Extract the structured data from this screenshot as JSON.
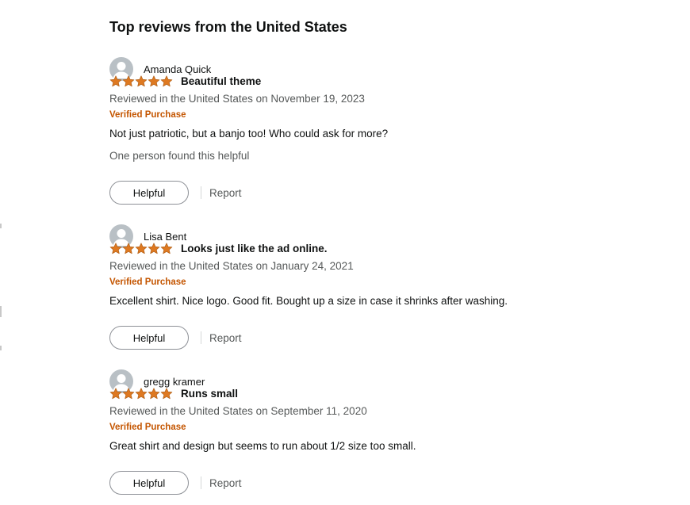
{
  "section_title": "Top reviews from the United States",
  "colors": {
    "star": "#de7921",
    "verified": "#c45500",
    "muted_text": "#565959",
    "text": "#0f1111"
  },
  "reviews": [
    {
      "reviewer": "Amanda Quick",
      "rating": 5,
      "title": "Beautiful theme",
      "date": "Reviewed in the United States on November 19, 2023",
      "verified": "Verified Purchase",
      "body": "Not just patriotic, but a banjo too! Who could ask for more?",
      "helpful_count": "One person found this helpful",
      "helpful_label": "Helpful",
      "report_label": "Report"
    },
    {
      "reviewer": "Lisa Bent",
      "rating": 5,
      "title": "Looks just like the ad online.",
      "date": "Reviewed in the United States on January 24, 2021",
      "verified": "Verified Purchase",
      "body": "Excellent shirt. Nice logo. Good fit. Bought up a size in case it shrinks after washing.",
      "helpful_label": "Helpful",
      "report_label": "Report"
    },
    {
      "reviewer": "gregg kramer",
      "rating": 5,
      "title": "Runs small",
      "date": "Reviewed in the United States on September 11, 2020",
      "verified": "Verified Purchase",
      "body": "Great shirt and design but seems to run about 1/2 size too small.",
      "helpful_label": "Helpful",
      "report_label": "Report"
    }
  ],
  "icons": {
    "avatar": "user-avatar-icon",
    "star": "star-icon"
  }
}
